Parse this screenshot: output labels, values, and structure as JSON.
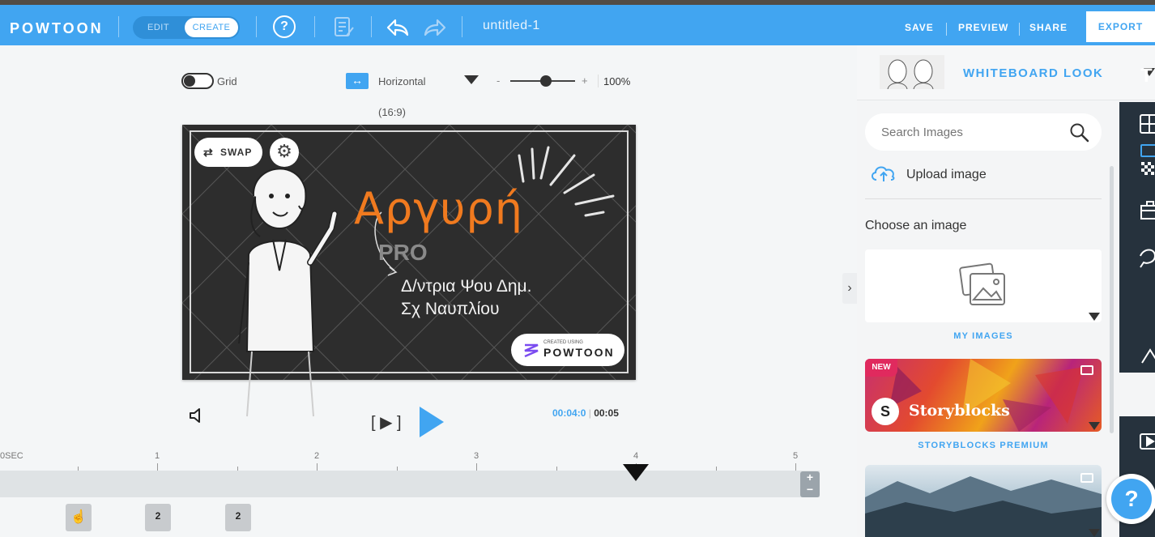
{
  "app": {
    "logo": "POWTOON"
  },
  "topbar": {
    "mode_edit": "EDIT",
    "mode_create": "CREATE",
    "help_icon": "help-circle-icon",
    "project_title": "untitled-1",
    "save": "SAVE",
    "preview": "PREVIEW",
    "share": "SHARE",
    "export": "EXPORT"
  },
  "canvas_controls": {
    "grid_label": "Grid",
    "orientation": "Horizontal",
    "ratio": "(16:9)",
    "zoom_minus": "-",
    "zoom_plus": "+",
    "zoom": "100%",
    "zoom_level": 0.55
  },
  "slide": {
    "swap_label": "SWAP",
    "title": "Αργυρή",
    "pro": "PRO",
    "line1": "Δ/ντρια Ψου Δημ.",
    "line2": "Σχ Ναυπλίου",
    "badge_small": "CREATED USING",
    "badge_logo": "POWTOON"
  },
  "playback": {
    "current": "00:04:0",
    "separator": "|",
    "total": "00:05",
    "step_label": "[ ▶ ]"
  },
  "timeline": {
    "ticks": [
      "0SEC",
      "1",
      "2",
      "3",
      "4",
      "5"
    ],
    "playhead_position_sec": 4,
    "zoom_in": "+",
    "zoom_out": "−",
    "thumbs": [
      {
        "label": ""
      },
      {
        "label": "2"
      },
      {
        "label": "2"
      }
    ]
  },
  "panel": {
    "style_name": "WHITEBOARD LOOK",
    "search_placeholder": "Search Images",
    "upload": "Upload image",
    "choose": "Choose an image",
    "my_images": "MY IMAGES",
    "storyblocks_badge": "NEW",
    "storyblocks_name": "Storyblocks",
    "storyblocks_caption": "STORYBLOCKS PREMIUM",
    "help_bubble": "?"
  },
  "colors": {
    "accent": "#41a5f1",
    "chalkboard": "#2a2a2a",
    "title_orange": "#f07a1f",
    "sidebar": "#26323d"
  }
}
